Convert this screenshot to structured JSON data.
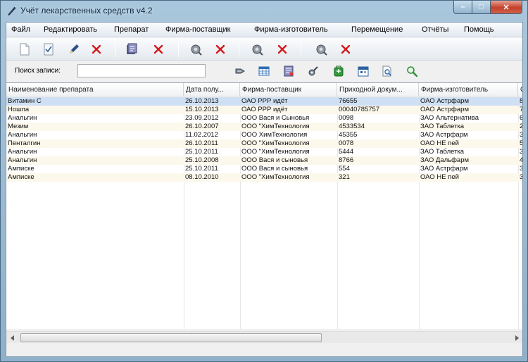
{
  "window": {
    "title": "Учёт лекарственных средств v4.2",
    "controls": {
      "minimize": "–",
      "maximize": "□",
      "close": "✕"
    }
  },
  "menu": [
    "Файл",
    "Редактировать",
    "Препарат",
    "Фирма-поставщик",
    "Фирма-изготовитель",
    "Перемещение",
    "Отчёты",
    "Помощь"
  ],
  "toolbar": {
    "groups": [
      {
        "icons": [
          "new-document-icon",
          "edit-document-icon",
          "pencil-icon",
          "delete-icon"
        ]
      },
      {
        "icons": [
          "drug-icon",
          "delete-icon"
        ]
      },
      {
        "icons": [
          "supplier-icon",
          "delete-icon"
        ]
      },
      {
        "icons": [
          "manufacturer-icon",
          "delete-icon"
        ]
      },
      {
        "icons": [
          "movement-icon",
          "delete-icon"
        ]
      }
    ]
  },
  "search": {
    "label": "Поиск записи:",
    "value": "",
    "placeholder": ""
  },
  "toolbar2_icons": [
    "filter-icon",
    "table-icon",
    "report-icon",
    "tools-icon",
    "export-icon",
    "calendar-icon",
    "print-preview-icon",
    "search-icon"
  ],
  "grid": {
    "columns": [
      "Наименование препарата",
      "Дата полу...",
      "Фирма-поставщик",
      "Приходной докум...",
      "Фирма-изготовитель",
      "С"
    ],
    "rows": [
      [
        "Витамин С",
        "26.10.2013",
        "ОАО РРР идёт",
        "76655",
        "ОАО Астрфарм",
        "8("
      ],
      [
        "Ношпа",
        "15.10.2013",
        "ОАО РРР идёт",
        "00040785757",
        "ОАО Астрфарм",
        "7("
      ],
      [
        "Анальгин",
        "23.09.2012",
        "ООО Вася и Сыновья",
        "0098",
        "ЗАО Альтернатива",
        "6("
      ],
      [
        "Мезим",
        "26.10.2007",
        "ООО \"ХимТехнология",
        "4533534",
        "ЗАО Таблетка",
        "2("
      ],
      [
        "Анальгин",
        "11.02.2012",
        "ООО ХимТехнология",
        "45355",
        "ЗАО Астрфарм",
        "3("
      ],
      [
        "Пенталгин",
        "26.10.2011",
        "ООО \"ХимТехнология",
        "0078",
        "ОАО НЕ пей",
        "5("
      ],
      [
        "Анальгин",
        "25.10.2011",
        "ООО \"ХимТехнология",
        "5444",
        "ЗАО Таблетка",
        "3("
      ],
      [
        "Анальгин",
        "25.10.2008",
        "ООО Вася и сыновья",
        "8766",
        "ЗАО Дальфарм",
        "4("
      ],
      [
        "Амписке",
        "25.10.2011",
        "ООО Вася и сыновья",
        "554",
        "ЗАО Астрфарм",
        "3("
      ],
      [
        "Амписке",
        "08.10.2010",
        "ООО \"ХимТехнология",
        "321",
        "ОАО НЕ пей",
        "3("
      ]
    ],
    "selected_row": 0
  },
  "colors": {
    "selected_row": "#cfe0f4",
    "alt_row": "#fdf8ec",
    "delete_icon": "#d4191c"
  }
}
